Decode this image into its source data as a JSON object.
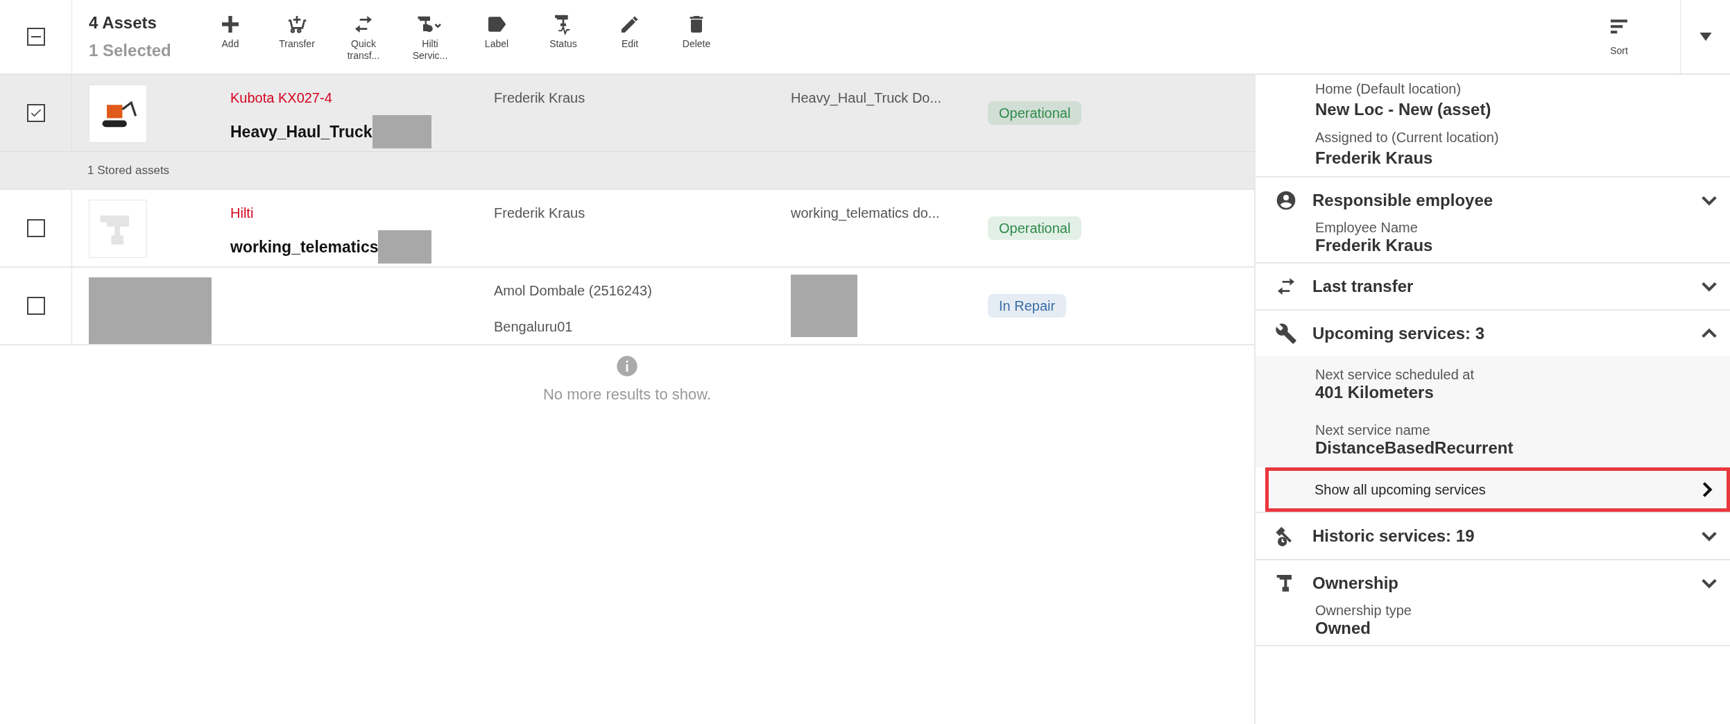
{
  "toolbar": {
    "select_all": {
      "indeterminate": true
    },
    "title": "4 Assets",
    "subtitle": "1 Selected",
    "actions": [
      {
        "label": "Add",
        "kind": "add"
      },
      {
        "label": "Transfer",
        "kind": "transfer"
      },
      {
        "label": "Quick\ntransf...",
        "kind": "quick"
      },
      {
        "label": "Hilti\nServic...",
        "kind": "service"
      },
      {
        "label": "Label",
        "kind": "label"
      },
      {
        "label": "Status",
        "kind": "status"
      },
      {
        "label": "Edit",
        "kind": "edit"
      },
      {
        "label": "Delete",
        "kind": "delete"
      }
    ],
    "sort": "Sort"
  },
  "rows": [
    {
      "selected": true,
      "checked": true,
      "kind": "excavator",
      "brand": "Kubota KX027-4",
      "name": "Heavy_Haul_Truck",
      "employee": "Frederik Kraus",
      "description": "Heavy_Haul_Truck Do...",
      "status": "Operational",
      "color": "#2e8b4a",
      "stored": "1 Stored assets"
    },
    {
      "selected": false,
      "checked": false,
      "kind": "drill",
      "brand": "Hilti",
      "name": "working_telematics",
      "employee": "Frederik Kraus",
      "description": "working_telematics do...",
      "status": "Operational",
      "color": "#2e8b4a"
    },
    {
      "selected": false,
      "checked": false,
      "kind": "redacted",
      "employee": "Amol Dombale (2516243)",
      "location": "Bengaluru01",
      "status": "In Repair",
      "color": "#3a6ea5"
    }
  ],
  "footer_note": "No more results to show.",
  "details": {
    "top_fields": [
      {
        "label": "Home (Default location)",
        "value": "New Loc - New (asset)"
      },
      {
        "label": "Assigned to (Current location)",
        "value": "Frederik Kraus"
      }
    ],
    "sections": [
      {
        "kind": "person",
        "title": "Responsible employee",
        "expanded": false,
        "fields": [
          {
            "label": "Employee Name",
            "value": "Frederik Kraus"
          }
        ]
      },
      {
        "kind": "transfer",
        "title": "Last transfer",
        "expanded": false
      },
      {
        "kind": "wrench",
        "title": "Upcoming services: 3",
        "expanded": true,
        "fields": [
          {
            "label": "Next service scheduled at",
            "value": "401 Kilometers"
          },
          {
            "label": "Next service name",
            "value": "DistanceBasedRecurrent"
          }
        ],
        "link": "Show all upcoming services"
      },
      {
        "kind": "history",
        "title": "Historic services: 19",
        "expanded": false
      },
      {
        "kind": "drill",
        "title": "Ownership",
        "expanded": false,
        "fields": [
          {
            "label": "Ownership type",
            "value": "Owned"
          }
        ]
      }
    ]
  }
}
